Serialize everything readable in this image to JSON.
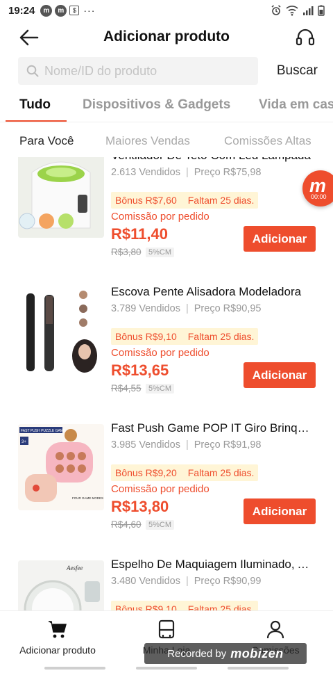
{
  "status_bar": {
    "time": "19:24",
    "notif_1": "m",
    "notif_2": "m",
    "notif_3": "$",
    "dots": "···"
  },
  "header": {
    "title": "Adicionar produto"
  },
  "search": {
    "placeholder": "Nome/ID do produto",
    "value": "",
    "button_label": "Buscar"
  },
  "category_tabs": [
    "Tudo",
    "Dispositivos & Gadgets",
    "Vida em casa"
  ],
  "sub_tabs": [
    "Para Você",
    "Maiores Vendas",
    "Comissões Altas"
  ],
  "products": [
    {
      "name": "Ventilador De Teto Com Led Lampada",
      "sold": "2.613 Vendidos",
      "price_label": "Preço R$75,98",
      "bonus": "Bônus R$7,60",
      "days_left": "Faltam 25 dias.",
      "commission_label": "Comissão por pedido",
      "commission_price": "R$11,40",
      "old_commission": "R$3,80",
      "rate": "5%CM",
      "button": "Adicionar"
    },
    {
      "name": "Escova Pente Alisadora Modeladora",
      "sold": "3.789 Vendidos",
      "price_label": "Preço R$90,95",
      "bonus": "Bônus R$9,10",
      "days_left": "Faltam 25 dias.",
      "commission_label": "Comissão por pedido",
      "commission_price": "R$13,65",
      "old_commission": "R$4,55",
      "rate": "5%CM",
      "button": "Adicionar"
    },
    {
      "name": "Fast Push Game POP IT Giro Brinquedo",
      "sold": "3.985 Vendidos",
      "price_label": "Preço R$91,98",
      "bonus": "Bônus R$9,20",
      "days_left": "Faltam 25 dias.",
      "commission_label": "Comissão por pedido",
      "commission_price": "R$13,80",
      "old_commission": "R$4,60",
      "rate": "5%CM",
      "button": "Adicionar",
      "thumb_text": {
        "top": "FAST PUSH PUZZLE GAME",
        "age": "3+",
        "bottom": "FOUR GAME MODES"
      }
    },
    {
      "name": "Espelho De Maquiagem Iluminado, Aesfee",
      "sold": "3.480 Vendidos",
      "price_label": "Preço R$90,99",
      "bonus": "Bônus R$9,10",
      "days_left": "Faltam 25 dias.",
      "thumb_text": {
        "brand": "Aesfee"
      }
    }
  ],
  "floating_badge": {
    "letter": "m",
    "timer": "00:00"
  },
  "bottom_nav": [
    "Adicionar produto",
    "Minha Loja",
    "Comissões"
  ],
  "watermark": {
    "prefix": "Recorded by",
    "brand": "mobizen"
  },
  "colors": {
    "accent": "#ee4d2d",
    "bonus_bg": "#fff5d6"
  }
}
